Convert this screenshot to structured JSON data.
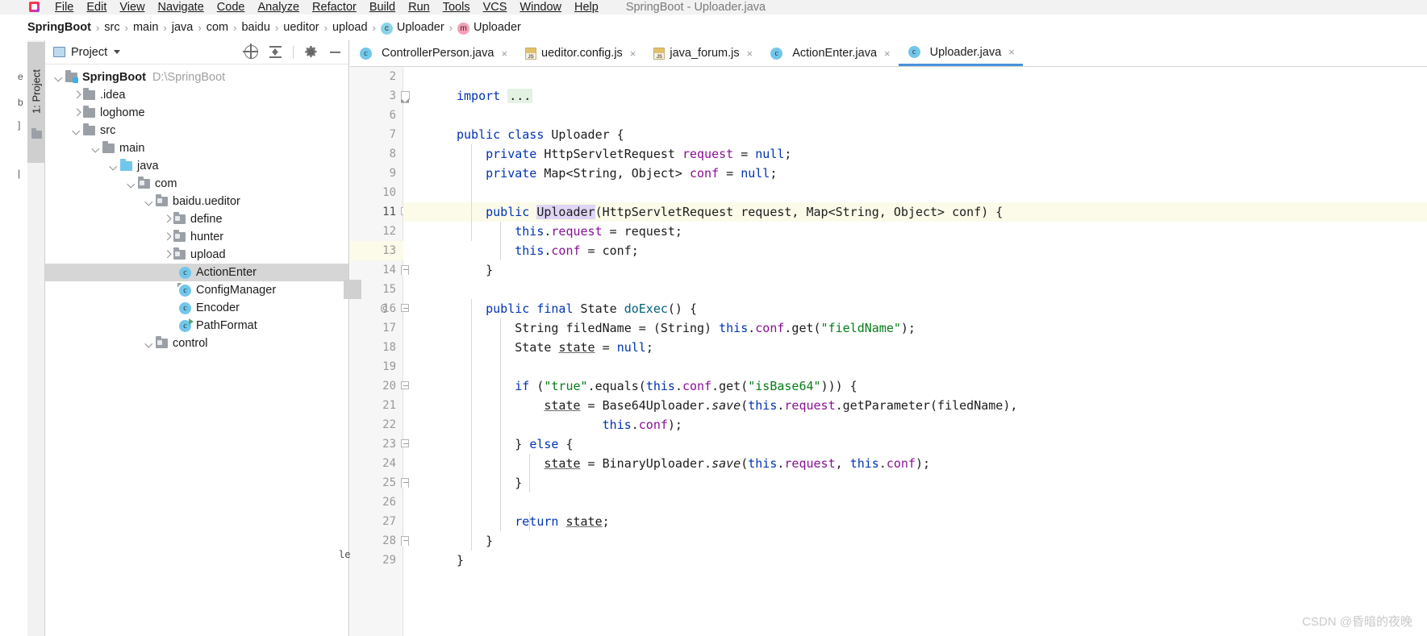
{
  "window": {
    "title": "SpringBoot - Uploader.java",
    "logo_icon": "intellij-idea-logo"
  },
  "menubar": {
    "items": [
      {
        "label": "File"
      },
      {
        "label": "Edit"
      },
      {
        "label": "View"
      },
      {
        "label": "Navigate"
      },
      {
        "label": "Code"
      },
      {
        "label": "Analyze"
      },
      {
        "label": "Refactor"
      },
      {
        "label": "Build"
      },
      {
        "label": "Run"
      },
      {
        "label": "Tools"
      },
      {
        "label": "VCS"
      },
      {
        "label": "Window"
      },
      {
        "label": "Help"
      }
    ]
  },
  "breadcrumb": {
    "items": [
      {
        "label": "SpringBoot",
        "bold": true,
        "badge": ""
      },
      {
        "label": "src",
        "bold": false,
        "badge": ""
      },
      {
        "label": "main",
        "bold": false,
        "badge": ""
      },
      {
        "label": "java",
        "bold": false,
        "badge": ""
      },
      {
        "label": "com",
        "bold": false,
        "badge": ""
      },
      {
        "label": "baidu",
        "bold": false,
        "badge": ""
      },
      {
        "label": "ueditor",
        "bold": false,
        "badge": ""
      },
      {
        "label": "upload",
        "bold": false,
        "badge": ""
      },
      {
        "label": "Uploader",
        "bold": false,
        "badge": "c"
      },
      {
        "label": "Uploader",
        "bold": false,
        "badge": "m"
      }
    ],
    "separator": "›"
  },
  "toolstrip": {
    "project_tab_label": "1: Project",
    "folder_icon": "folder-icon"
  },
  "project_panel": {
    "title": "Project",
    "window_icon": "project-window-icon",
    "caret_icon": "chevron-down-icon",
    "tools": [
      {
        "name": "locate-icon",
        "label": ""
      },
      {
        "name": "collapse-all-icon",
        "label": ""
      },
      {
        "name": "gear-icon",
        "label": ""
      },
      {
        "name": "minimize-icon",
        "label": ""
      }
    ],
    "tree": [
      {
        "label": "SpringBoot",
        "path": "D:\\SpringBoot",
        "depth": 0,
        "arrow": "down",
        "icon": "module-folder",
        "bold": true,
        "selected": false
      },
      {
        "label": ".idea",
        "path": "",
        "depth": 1,
        "arrow": "right",
        "icon": "folder",
        "bold": false,
        "selected": false
      },
      {
        "label": "loghome",
        "path": "",
        "depth": 1,
        "arrow": "right",
        "icon": "folder",
        "bold": false,
        "selected": false
      },
      {
        "label": "src",
        "path": "",
        "depth": 1,
        "arrow": "down",
        "icon": "folder",
        "bold": false,
        "selected": false
      },
      {
        "label": "main",
        "path": "",
        "depth": 2,
        "arrow": "down",
        "icon": "folder",
        "bold": false,
        "selected": false
      },
      {
        "label": "java",
        "path": "",
        "depth": 3,
        "arrow": "down",
        "icon": "source-folder",
        "bold": false,
        "selected": false
      },
      {
        "label": "com",
        "path": "",
        "depth": 4,
        "arrow": "down",
        "icon": "package-folder",
        "bold": false,
        "selected": false
      },
      {
        "label": "baidu.ueditor",
        "path": "",
        "depth": 5,
        "arrow": "down",
        "icon": "package-folder",
        "bold": false,
        "selected": false
      },
      {
        "label": "define",
        "path": "",
        "depth": 6,
        "arrow": "right",
        "icon": "package-folder",
        "bold": false,
        "selected": false
      },
      {
        "label": "hunter",
        "path": "",
        "depth": 6,
        "arrow": "right",
        "icon": "package-folder",
        "bold": false,
        "selected": false
      },
      {
        "label": "upload",
        "path": "",
        "depth": 6,
        "arrow": "right",
        "icon": "package-folder",
        "bold": false,
        "selected": false
      },
      {
        "label": "ActionEnter",
        "path": "",
        "depth": 7,
        "arrow": "none",
        "icon": "java-class",
        "bold": false,
        "selected": true
      },
      {
        "label": "ConfigManager",
        "path": "",
        "depth": 7,
        "arrow": "none",
        "icon": "java-class-marked",
        "bold": false,
        "selected": false
      },
      {
        "label": "Encoder",
        "path": "",
        "depth": 7,
        "arrow": "none",
        "icon": "java-class",
        "bold": false,
        "selected": false
      },
      {
        "label": "PathFormat",
        "path": "",
        "depth": 7,
        "arrow": "none",
        "icon": "java-class-runnable",
        "bold": false,
        "selected": false
      },
      {
        "label": "control",
        "path": "",
        "depth": 5,
        "arrow": "down",
        "icon": "package-folder",
        "bold": false,
        "selected": false
      }
    ]
  },
  "editor": {
    "tabs": [
      {
        "label": "ControllerPerson.java",
        "icon": "java-class-icon",
        "active": false,
        "close": "×"
      },
      {
        "label": "ueditor.config.js",
        "icon": "js-file-icon",
        "active": false,
        "close": "×"
      },
      {
        "label": "java_forum.js",
        "icon": "js-file-icon",
        "active": false,
        "close": "×"
      },
      {
        "label": "ActionEnter.java",
        "icon": "java-class-icon",
        "active": false,
        "close": "×"
      },
      {
        "label": "Uploader.java",
        "icon": "java-class-icon",
        "active": true,
        "close": "×"
      }
    ],
    "line_numbers": [
      "2",
      "3",
      "6",
      "7",
      "8",
      "9",
      "10",
      "11",
      "12",
      "13",
      "14",
      "15",
      "16",
      "17",
      "18",
      "19",
      "20",
      "21",
      "22",
      "23",
      "24",
      "25",
      "26",
      "27",
      "28",
      "29"
    ],
    "current_line": "11",
    "gutter_annotation_line": "16",
    "gutter_annotation": "@",
    "fold_placeholder": "...",
    "left_edge_text": "le",
    "code_lines": [
      {
        "n": "2",
        "text": ""
      },
      {
        "n": "3",
        "text": "import ..."
      },
      {
        "n": "6",
        "text": ""
      },
      {
        "n": "7",
        "text": "public class Uploader {"
      },
      {
        "n": "8",
        "text": "    private HttpServletRequest request = null;"
      },
      {
        "n": "9",
        "text": "    private Map<String, Object> conf = null;"
      },
      {
        "n": "10",
        "text": ""
      },
      {
        "n": "11",
        "text": "    public Uploader(HttpServletRequest request, Map<String, Object> conf) {"
      },
      {
        "n": "12",
        "text": "        this.request = request;"
      },
      {
        "n": "13",
        "text": "        this.conf = conf;"
      },
      {
        "n": "14",
        "text": "    }"
      },
      {
        "n": "15",
        "text": ""
      },
      {
        "n": "16",
        "text": "    public final State doExec() {"
      },
      {
        "n": "17",
        "text": "        String filedName = (String) this.conf.get(\"fieldName\");"
      },
      {
        "n": "18",
        "text": "        State state = null;"
      },
      {
        "n": "19",
        "text": ""
      },
      {
        "n": "20",
        "text": "        if (\"true\".equals(this.conf.get(\"isBase64\"))) {"
      },
      {
        "n": "21",
        "text": "            state = Base64Uploader.save(this.request.getParameter(filedName),"
      },
      {
        "n": "22",
        "text": "                    this.conf);"
      },
      {
        "n": "23",
        "text": "        } else {"
      },
      {
        "n": "24",
        "text": "            state = BinaryUploader.save(this.request, this.conf);"
      },
      {
        "n": "25",
        "text": "        }"
      },
      {
        "n": "26",
        "text": ""
      },
      {
        "n": "27",
        "text": "        return state;"
      },
      {
        "n": "28",
        "text": "    }"
      },
      {
        "n": "29",
        "text": "}"
      }
    ]
  },
  "watermark": {
    "text": "CSDN @昏暗的夜晚"
  },
  "colors": {
    "keyword": "#0033b3",
    "string": "#067d17",
    "field": "#871094",
    "number": "#1750eb",
    "accent": "#4a90d9",
    "current_line_bg": "#fcfbe9",
    "selection_bg": "#d6d6d6"
  }
}
